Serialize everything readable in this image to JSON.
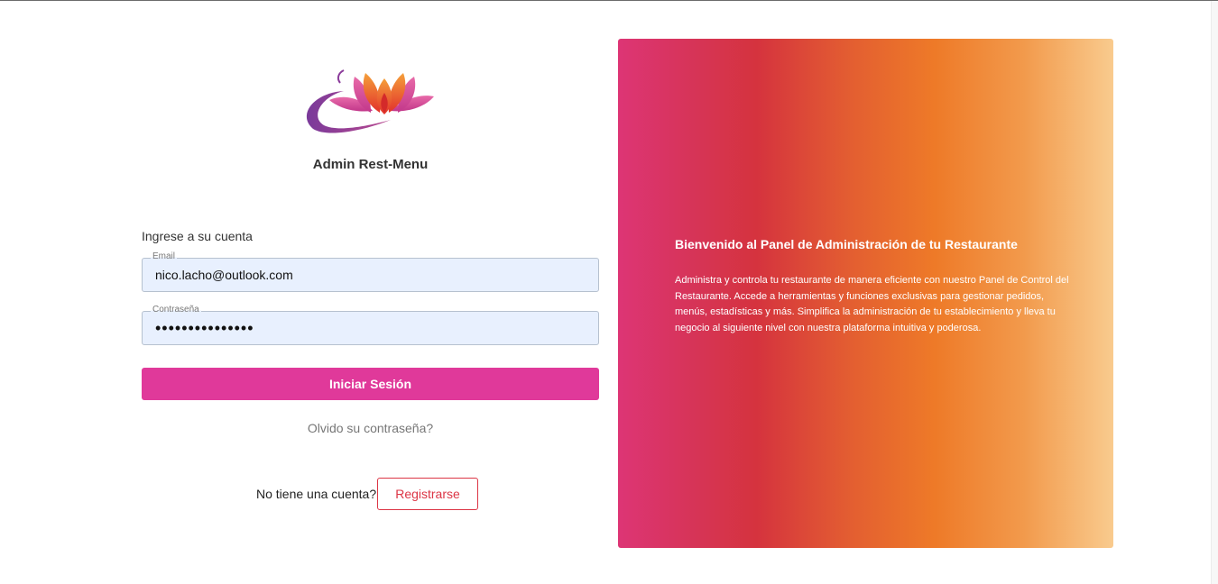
{
  "brand": {
    "name": "Admin Rest-Menu"
  },
  "login": {
    "intro": "Ingrese a su cuenta",
    "email_label": "Email",
    "email_value": "nico.lacho@outlook.com",
    "password_label": "Contraseña",
    "password_value": "•••••••••••••••",
    "submit_label": "Iniciar Sesión",
    "forgot_label": "Olvido su contraseña?",
    "no_account_text": "No tiene una cuenta?",
    "register_label": "Registrarse"
  },
  "promo": {
    "title": "Bienvenido al Panel de Administración de tu Restaurante",
    "body": "Administra y controla tu restaurante de manera eficiente con nuestro Panel de Control del Restaurante. Accede a herramientas y funciones exclusivas para gestionar pedidos, menús, estadísticas y más. Simplifica la administración de tu establecimiento y lleva tu negocio al siguiente nivel con nuestra plataforma intuitiva y poderosa."
  },
  "colors": {
    "primary_button": "#e0399a",
    "register_border": "#dc3545",
    "input_bg": "#e8f0fe",
    "gradient": [
      "#dd3575",
      "#d5333e",
      "#ee7a28",
      "#f9cb8e"
    ]
  },
  "icons": {
    "logo": "lotus-logo-icon"
  }
}
